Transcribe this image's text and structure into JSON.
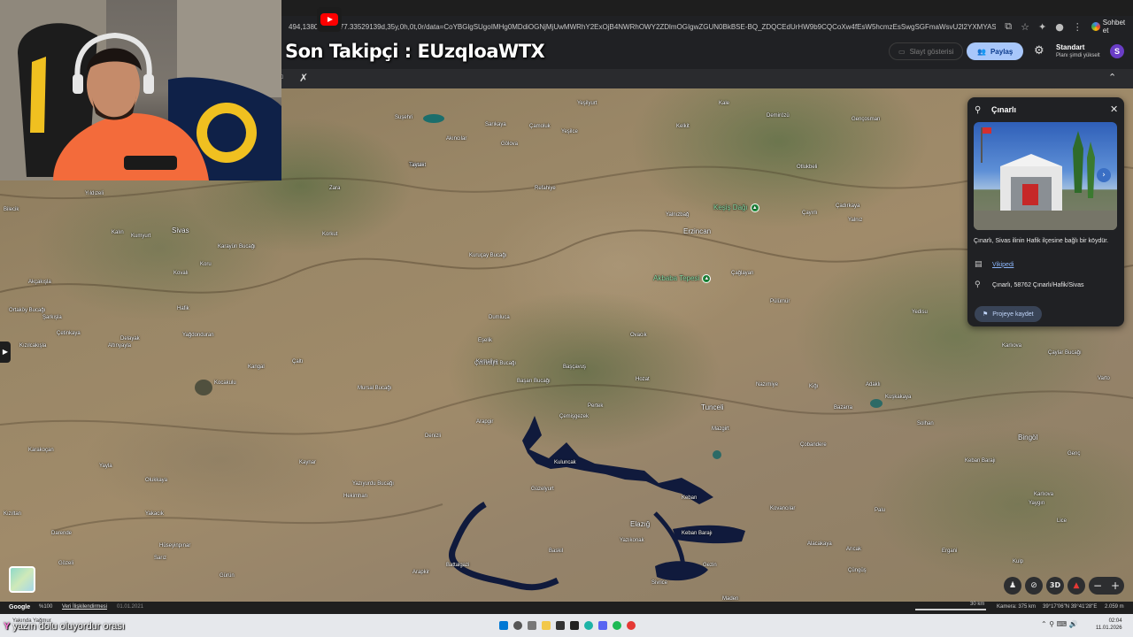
{
  "browser": {
    "url": "494,1380.8773677.33529139d,35y,0h,0t,0r/data=CoYBGlgSUgoIMHg0MDdiOGNjMjUwMWRhY2ExOjB4NWRhOWY2ZDlmOGIgwZGUN0BkBSE-BQ_ZDQCEdUrHW9b9CQCoXw4fEsW5hcmzEsSwgSGFmaWsvU2l2YXMYASABIiYKJAkLT79iTvhDQBEJPnueN_...",
    "chat_label": "Sohbet et"
  },
  "stream": {
    "overlay_title": "Son Takipçi : EUzqIoaWTX",
    "chat_user": "Y",
    "chat_message": "yazın dolu oluyordur orası"
  },
  "earth": {
    "slide_label": "Slayt gösterisi",
    "share_label": "Paylaş",
    "plan_title": "Standart",
    "plan_subtitle": "Planı şimdi yükselt",
    "avatar_letter": "S"
  },
  "map": {
    "places": [
      {
        "name": "Suşehri",
        "type": "town"
      },
      {
        "name": "Sarıkaya",
        "type": "town"
      },
      {
        "name": "Çamoluk",
        "type": "town"
      },
      {
        "name": "Akıncılar",
        "type": "town"
      },
      {
        "name": "Gölova",
        "type": "town"
      },
      {
        "name": "Yeşilce",
        "type": "town"
      },
      {
        "name": "Tiryakit",
        "type": "town"
      },
      {
        "name": "Kelkit",
        "type": "town"
      },
      {
        "name": "Demirözü",
        "type": "town"
      },
      {
        "name": "Gençosman",
        "type": "town"
      },
      {
        "name": "Yeşilyurt",
        "type": "town"
      },
      {
        "name": "Kale",
        "type": "town"
      },
      {
        "name": "Taktak",
        "type": "town"
      },
      {
        "name": "Zara",
        "type": "town"
      },
      {
        "name": "Refahiye",
        "type": "town"
      },
      {
        "name": "Otlukbeli",
        "type": "town"
      },
      {
        "name": "Yıldızeli",
        "type": "town"
      },
      {
        "name": "Bilecik",
        "type": "town"
      },
      {
        "name": "Kalın",
        "type": "town"
      },
      {
        "name": "Kumyurt",
        "type": "town"
      },
      {
        "name": "Sivas",
        "type": "city"
      },
      {
        "name": "Karayün Bucağı",
        "type": "town"
      },
      {
        "name": "Koru",
        "type": "town"
      },
      {
        "name": "Korkut",
        "type": "town"
      },
      {
        "name": "Yalnızbağ",
        "type": "town"
      },
      {
        "name": "Erzincan",
        "type": "city"
      },
      {
        "name": "Çayırlı",
        "type": "town"
      },
      {
        "name": "Çadırkaya",
        "type": "town"
      },
      {
        "name": "Yalnız",
        "type": "town"
      },
      {
        "name": "Kuruçay Bucağı",
        "type": "town"
      },
      {
        "name": "Kovalı",
        "type": "town"
      },
      {
        "name": "Akçakışla",
        "type": "town"
      },
      {
        "name": "Çağlayan",
        "type": "town"
      },
      {
        "name": "Hafik",
        "type": "town"
      },
      {
        "name": "Ortaköy Bucağı",
        "type": "town"
      },
      {
        "name": "Şarkışla",
        "type": "town"
      },
      {
        "name": "Çetinkaya",
        "type": "town"
      },
      {
        "name": "Kızılcakışla",
        "type": "town"
      },
      {
        "name": "Altınyayla",
        "type": "town"
      },
      {
        "name": "Delayak",
        "type": "town"
      },
      {
        "name": "Yağdonduran",
        "type": "town"
      },
      {
        "name": "Çaltı",
        "type": "town"
      },
      {
        "name": "Dumluca",
        "type": "town"
      },
      {
        "name": "Ovacık",
        "type": "town"
      },
      {
        "name": "Pülümür",
        "type": "town"
      },
      {
        "name": "Yedisu",
        "type": "town"
      },
      {
        "name": "Karlıova",
        "type": "town"
      },
      {
        "name": "Çaylar Bucağı",
        "type": "town"
      },
      {
        "name": "Kangal",
        "type": "town"
      },
      {
        "name": "Çetinkaya Bucağı",
        "type": "town"
      },
      {
        "name": "Eşelik",
        "type": "town"
      },
      {
        "name": "Kemaliye",
        "type": "town"
      },
      {
        "name": "Başçavuş",
        "type": "town"
      },
      {
        "name": "Hozat",
        "type": "town"
      },
      {
        "name": "Nazımiye",
        "type": "town"
      },
      {
        "name": "Kiğı",
        "type": "town"
      },
      {
        "name": "Adaklı",
        "type": "town"
      },
      {
        "name": "Varto",
        "type": "town"
      },
      {
        "name": "Kocakulu",
        "type": "town"
      },
      {
        "name": "Mursal Bucağı",
        "type": "town"
      },
      {
        "name": "Başarı Bucağı",
        "type": "town"
      },
      {
        "name": "Tunceli",
        "type": "city"
      },
      {
        "name": "Bazarra",
        "type": "town"
      },
      {
        "name": "Kuşkakaya",
        "type": "town"
      },
      {
        "name": "Arapgir",
        "type": "town"
      },
      {
        "name": "Çemişgezek",
        "type": "town"
      },
      {
        "name": "Pertek",
        "type": "town"
      },
      {
        "name": "Mazgirt",
        "type": "town"
      },
      {
        "name": "Bingöl",
        "type": "city"
      },
      {
        "name": "Solhan",
        "type": "town"
      },
      {
        "name": "Denizli",
        "type": "town"
      },
      {
        "name": "Çobandere",
        "type": "town"
      },
      {
        "name": "Karakoçan",
        "type": "town"
      },
      {
        "name": "Kaynar",
        "type": "town"
      },
      {
        "name": "Kuluncak",
        "type": "town"
      },
      {
        "name": "Keban Barajı",
        "type": "town"
      },
      {
        "name": "Genç",
        "type": "town"
      },
      {
        "name": "Yayla",
        "type": "town"
      },
      {
        "name": "Olukkaya",
        "type": "town"
      },
      {
        "name": "Yazıyurdu Bucağı",
        "type": "town"
      },
      {
        "name": "Hekimhan",
        "type": "town"
      },
      {
        "name": "Güzelyurt",
        "type": "town"
      },
      {
        "name": "Keban",
        "type": "town"
      },
      {
        "name": "Palu",
        "type": "town"
      },
      {
        "name": "Karlıova",
        "type": "town"
      },
      {
        "name": "Elazığ",
        "type": "city"
      },
      {
        "name": "Kovancılar",
        "type": "town"
      },
      {
        "name": "Kızıltan",
        "type": "town"
      },
      {
        "name": "Yakacık",
        "type": "town"
      },
      {
        "name": "Darende",
        "type": "town"
      },
      {
        "name": "Hüseyinpınar",
        "type": "town"
      },
      {
        "name": "Yazıkonak",
        "type": "town"
      },
      {
        "name": "Keban Barajı",
        "type": "town"
      },
      {
        "name": "Baskil",
        "type": "town"
      },
      {
        "name": "Alacakaya",
        "type": "town"
      },
      {
        "name": "Arıcak",
        "type": "town"
      },
      {
        "name": "Ergani",
        "type": "town"
      },
      {
        "name": "Yaygın",
        "type": "town"
      },
      {
        "name": "Lice",
        "type": "town"
      },
      {
        "name": "Gözeli",
        "type": "town"
      },
      {
        "name": "Sarız",
        "type": "town"
      },
      {
        "name": "Gürün",
        "type": "town"
      },
      {
        "name": "Gezin",
        "type": "town"
      },
      {
        "name": "Sivrice",
        "type": "town"
      },
      {
        "name": "Çüngüş",
        "type": "town"
      },
      {
        "name": "Kulp",
        "type": "town"
      },
      {
        "name": "Battalgazi",
        "type": "town"
      },
      {
        "name": "Arapkir",
        "type": "town"
      },
      {
        "name": "Maden",
        "type": "town"
      }
    ],
    "pois": [
      {
        "name": "Keşiş Dağı",
        "icon": "▲"
      },
      {
        "name": "Akbaba Tepesi",
        "icon": "▲"
      }
    ]
  },
  "panel": {
    "title": "Çınarlı",
    "description": "Çınarlı, Sivas ilinin Hafik ilçesine bağlı bir köydür.",
    "wiki_label": "Vikipedi",
    "address": "Çınarlı, 58762 Çınarlı/Hafik/Sivas",
    "save_label": "Projeye kaydet"
  },
  "controls": {
    "mode_3d": "3D"
  },
  "status": {
    "google": "Google",
    "zoom": "%100",
    "data_link": "Veri İlişkilendirmesi",
    "date": "01.01.2021",
    "scale": "30 km",
    "camera": "Kamera: 375 km",
    "coords": "39°17'06\"N 39°41'28\"E",
    "elevation": "2.059 m"
  },
  "taskbar": {
    "weather": "Yakında Yağmur",
    "time": "02:04",
    "date": "11.01.2026"
  },
  "colors": {
    "share_bg": "#a8c7fa",
    "poi_green": "#1e8e3e",
    "water": "#101a3c",
    "link": "#8ab4f8"
  }
}
